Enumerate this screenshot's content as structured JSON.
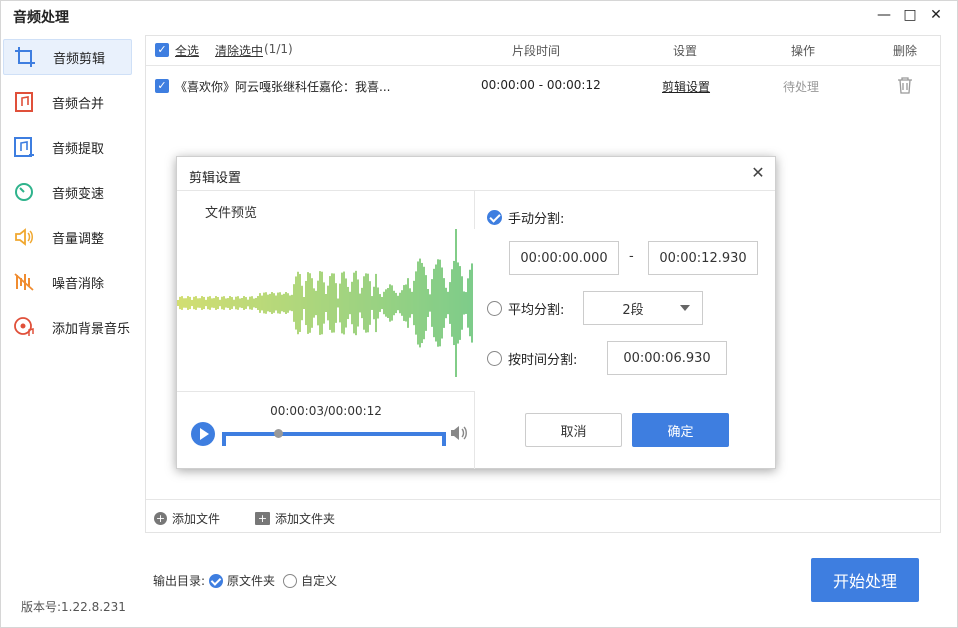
{
  "window": {
    "title": "音频处理",
    "minimize_glyph": "—",
    "maximize_glyph": "□",
    "close_glyph": "✕"
  },
  "sidebar": {
    "items": [
      {
        "label": "音频剪辑",
        "icon": "crop-icon",
        "active": true
      },
      {
        "label": "音频合并",
        "icon": "merge-icon"
      },
      {
        "label": "音频提取",
        "icon": "music-file-icon"
      },
      {
        "label": "音频变速",
        "icon": "speed-icon"
      },
      {
        "label": "音量调整",
        "icon": "volume-icon"
      },
      {
        "label": "噪音消除",
        "icon": "noise-icon"
      },
      {
        "label": "添加背景音乐",
        "icon": "music-disc-icon"
      }
    ]
  },
  "version": "版本号:1.22.8.231",
  "table": {
    "select_all": "全选",
    "clear_selected": "清除选中",
    "count": "(1/1)",
    "col_segment": "片段时间",
    "col_settings": "设置",
    "col_action": "操作",
    "col_delete": "删除",
    "rows": [
      {
        "name": "《喜欢你》阿云嘎张继科任嘉伦：我喜...",
        "time": "00:00:00 - 00:00:12",
        "settings": "剪辑设置",
        "status": "待处理"
      }
    ]
  },
  "footer": {
    "add_file": "添加文件",
    "add_folder": "添加文件夹"
  },
  "output": {
    "label": "输出目录:",
    "opt_original": "原文件夹",
    "opt_custom": "自定义"
  },
  "start_button": "开始处理",
  "dialog": {
    "title": "剪辑设置",
    "close_glyph": "✕",
    "preview_label": "文件预览",
    "time_display": "00:00:03/00:00:12",
    "manual": {
      "label": "手动分割:",
      "start": "00:00:00.000",
      "dash": "-",
      "end": "00:00:12.930"
    },
    "average": {
      "label": "平均分割:",
      "value": "2段"
    },
    "by_time": {
      "label": "按时间分割:",
      "value": "00:00:06.930"
    },
    "cancel": "取消",
    "confirm": "确定",
    "playback_position": 0.25
  },
  "colors": {
    "accent": "#3e7ee0"
  }
}
